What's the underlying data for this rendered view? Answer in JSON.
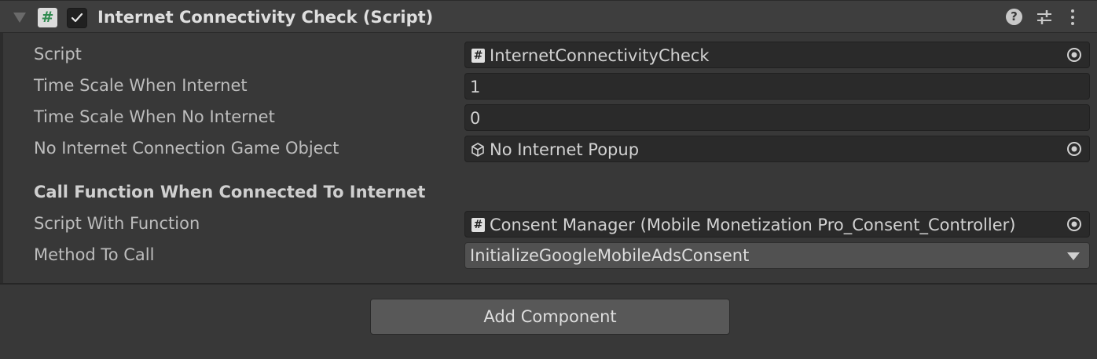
{
  "component": {
    "title": "Internet Connectivity Check (Script)",
    "enabled": true,
    "script_icon_glyph": "#"
  },
  "fields": {
    "script": {
      "label": "Script",
      "value": "InternetConnectivityCheck",
      "icon": "csharp-script-icon"
    },
    "time_scale_internet": {
      "label": "Time Scale When Internet",
      "value": "1"
    },
    "time_scale_no_internet": {
      "label": "Time Scale When No Internet",
      "value": "0"
    },
    "no_internet_object": {
      "label": "No Internet Connection Game Object",
      "value": "No Internet Popup",
      "icon": "gameobject-cube-icon"
    }
  },
  "section": {
    "title": "Call Function When Connected To Internet",
    "script_with_function": {
      "label": "Script With Function",
      "value": "Consent Manager (Mobile Monetization Pro_Consent_Controller)",
      "icon": "csharp-script-icon"
    },
    "method_to_call": {
      "label": "Method To Call",
      "value": "InitializeGoogleMobileAdsConsent"
    }
  },
  "buttons": {
    "add_component": "Add Component"
  },
  "colors": {
    "background": "#383838",
    "field_bg": "#2a2a2a",
    "script_icon_green": "#2f8a4f"
  }
}
